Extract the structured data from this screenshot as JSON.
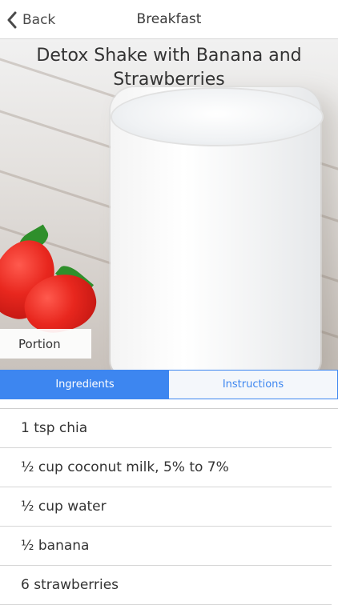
{
  "nav": {
    "back_label": "Back",
    "title": "Breakfast"
  },
  "hero": {
    "title": "Detox Shake with Banana and Strawberries",
    "portion_label": "Portion"
  },
  "tabs": [
    {
      "label": "Ingredients",
      "active": true
    },
    {
      "label": "Instructions",
      "active": false
    }
  ],
  "ingredients": [
    "1 tsp chia",
    "½ cup coconut milk, 5% to 7%",
    "½ cup water",
    "½ banana",
    "6 strawberries"
  ],
  "colors": {
    "accent": "#3d86f0"
  }
}
